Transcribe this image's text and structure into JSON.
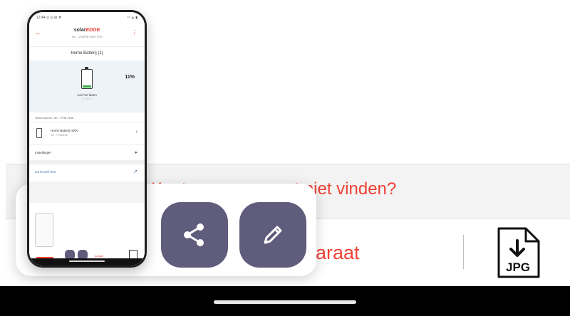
{
  "background": {
    "prompt_text": "Kunt u uw apparaat niet vinden?",
    "add_device_text": "paraat",
    "jpg_icon": {
      "icon": "jpg-file-icon",
      "label": "JPG"
    }
  },
  "screenshot_preview": {
    "status_bar": {
      "time": "12:44 ⊙ ⊡ ⊞ ▼",
      "right": "⁴⁶ ▲ ▮"
    },
    "header": {
      "logo_text": "solar",
      "logo_accent": "EDGE",
      "subtitle": "Inv. - ZSMPB 9000 TFB"
    },
    "title": "Home Batterij (1)",
    "battery": {
      "percent": "11%",
      "fill_fraction": 0.11,
      "status": "Aan het laden",
      "status_sub": "0 / 0 / 0"
    },
    "serial": "Serienummer: SE - 7F48 9186",
    "device": {
      "name": "Home Batterij 400V",
      "sub": "SN - 7F486186"
    },
    "settings_label": "Instellingen",
    "selftest_label": "Ga la Self Test",
    "mini_text": "paraat"
  },
  "actions": {
    "share": {
      "icon": "share-icon"
    },
    "edit": {
      "icon": "pencil-icon"
    }
  },
  "colors": {
    "accent_red": "#ef4136",
    "action_button": "#5f5c7c",
    "battery_green": "#38b04a"
  }
}
